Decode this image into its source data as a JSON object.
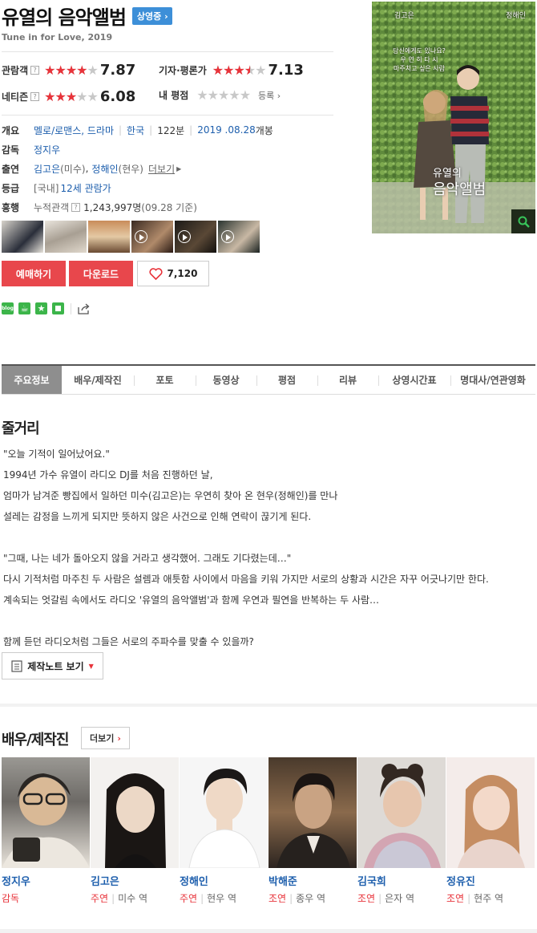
{
  "movie": {
    "title": "유열의 음악앨범",
    "status_badge": "상영중",
    "subtitle": "Tune in for Love, 2019"
  },
  "ratings": {
    "audience": {
      "label": "관람객",
      "score": "7.87",
      "fill": 0.787
    },
    "critic": {
      "label": "기자·평론가",
      "score": "7.13",
      "fill": 0.713
    },
    "netizen": {
      "label": "네티즌",
      "score": "6.08",
      "fill": 0.608
    },
    "mine": {
      "label": "내 평점",
      "fill": 0,
      "register": "등록"
    }
  },
  "info": {
    "overview_label": "개요",
    "genre": "멜로/로맨스, 드라마",
    "country": "한국",
    "runtime": "122분",
    "release_date": "2019 .08.28",
    "release_suffix": "개봉",
    "director_label": "감독",
    "director": "정지우",
    "cast_label": "출연",
    "cast_1": "김고은",
    "cast_1_role": "(미수)",
    "cast_2": "정해인",
    "cast_2_role": "(현우)",
    "cast_more": "더보기",
    "grade_label": "등급",
    "grade_region": "[국내]",
    "grade": "12세 관람가",
    "box_label": "흥행",
    "box_name": "누적관객",
    "box_value": "1,243,997명",
    "box_date": "(09.28 기준)"
  },
  "buttons": {
    "reserve": "예매하기",
    "download": "다운로드",
    "likes": "7,120"
  },
  "social": {
    "blog_icon": "blog"
  },
  "poster": {
    "name_left": "김고은",
    "name_right": "정해인",
    "tagline_1": "당신에게도 있나요?",
    "tagline_2": "우 연 히 다 시",
    "tagline_3": "마주치고 싶은 사람",
    "title_1": "유열의",
    "title_2": "음악앨범"
  },
  "tabs": [
    "주요정보",
    "배우/제작진",
    "포토",
    "동영상",
    "평점",
    "리뷰",
    "상영시간표",
    "명대사/연관영화"
  ],
  "synopsis": {
    "title": "줄거리",
    "lines": [
      "\"오늘 기적이 일어났어요.\"",
      " 1994년 가수 유열이 라디오 DJ를 처음 진행하던 날,",
      "엄마가 남겨준 빵집에서 일하던 미수(김고은)는 우연히 찾아 온 현우(정해인)를 만나",
      "설레는 감정을 느끼게 되지만 뜻하지 않은 사건으로 인해 연락이 끊기게 된다.",
      "",
      " \"그때, 나는 네가 돌아오지 않을 거라고 생각했어. 그래도 기다렸는데…\"",
      "다시 기적처럼 마주친 두 사람은 설렘과 애틋함 사이에서 마음을 키워 가지만 서로의 상황과 시간은 자꾸 어긋나기만 한다.",
      "계속되는 엇갈림 속에서도 라디오 '유열의 음악앨범'과 함께 우연과 필연을 반복하는 두 사람…",
      "",
      "함께 듣던 라디오처럼 그들은 서로의 주파수를 맞출 수 있을까?"
    ],
    "notes_button": "제작노트 보기"
  },
  "cast_section": {
    "title": "배우/제작진",
    "more": "더보기",
    "people": [
      {
        "name": "정지우",
        "role": "감독",
        "part": ""
      },
      {
        "name": "김고은",
        "role": "주연",
        "part": "미수 역"
      },
      {
        "name": "정해인",
        "role": "주연",
        "part": "현우 역"
      },
      {
        "name": "박해준",
        "role": "조연",
        "part": "종우 역"
      },
      {
        "name": "김국희",
        "role": "조연",
        "part": "은자 역"
      },
      {
        "name": "정유진",
        "role": "조연",
        "part": "현주 역"
      }
    ]
  },
  "colors": {
    "accent_red": "#e8474c",
    "link_blue": "#1e5fad",
    "badge_blue": "#3d8fd8"
  }
}
